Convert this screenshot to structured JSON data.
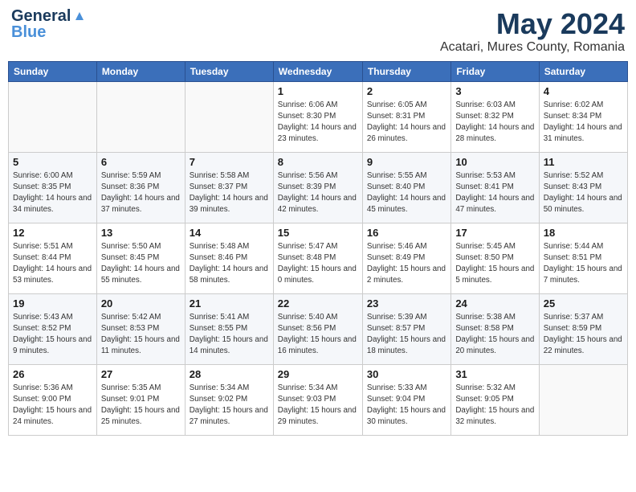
{
  "header": {
    "logo_line1": "General",
    "logo_line2": "Blue",
    "month_year": "May 2024",
    "location": "Acatari, Mures County, Romania"
  },
  "weekdays": [
    "Sunday",
    "Monday",
    "Tuesday",
    "Wednesday",
    "Thursday",
    "Friday",
    "Saturday"
  ],
  "weeks": [
    [
      {
        "day": "",
        "sunrise": "",
        "sunset": "",
        "daylight": ""
      },
      {
        "day": "",
        "sunrise": "",
        "sunset": "",
        "daylight": ""
      },
      {
        "day": "",
        "sunrise": "",
        "sunset": "",
        "daylight": ""
      },
      {
        "day": "1",
        "sunrise": "6:06 AM",
        "sunset": "8:30 PM",
        "daylight": "14 hours and 23 minutes."
      },
      {
        "day": "2",
        "sunrise": "6:05 AM",
        "sunset": "8:31 PM",
        "daylight": "14 hours and 26 minutes."
      },
      {
        "day": "3",
        "sunrise": "6:03 AM",
        "sunset": "8:32 PM",
        "daylight": "14 hours and 28 minutes."
      },
      {
        "day": "4",
        "sunrise": "6:02 AM",
        "sunset": "8:34 PM",
        "daylight": "14 hours and 31 minutes."
      }
    ],
    [
      {
        "day": "5",
        "sunrise": "6:00 AM",
        "sunset": "8:35 PM",
        "daylight": "14 hours and 34 minutes."
      },
      {
        "day": "6",
        "sunrise": "5:59 AM",
        "sunset": "8:36 PM",
        "daylight": "14 hours and 37 minutes."
      },
      {
        "day": "7",
        "sunrise": "5:58 AM",
        "sunset": "8:37 PM",
        "daylight": "14 hours and 39 minutes."
      },
      {
        "day": "8",
        "sunrise": "5:56 AM",
        "sunset": "8:39 PM",
        "daylight": "14 hours and 42 minutes."
      },
      {
        "day": "9",
        "sunrise": "5:55 AM",
        "sunset": "8:40 PM",
        "daylight": "14 hours and 45 minutes."
      },
      {
        "day": "10",
        "sunrise": "5:53 AM",
        "sunset": "8:41 PM",
        "daylight": "14 hours and 47 minutes."
      },
      {
        "day": "11",
        "sunrise": "5:52 AM",
        "sunset": "8:43 PM",
        "daylight": "14 hours and 50 minutes."
      }
    ],
    [
      {
        "day": "12",
        "sunrise": "5:51 AM",
        "sunset": "8:44 PM",
        "daylight": "14 hours and 53 minutes."
      },
      {
        "day": "13",
        "sunrise": "5:50 AM",
        "sunset": "8:45 PM",
        "daylight": "14 hours and 55 minutes."
      },
      {
        "day": "14",
        "sunrise": "5:48 AM",
        "sunset": "8:46 PM",
        "daylight": "14 hours and 58 minutes."
      },
      {
        "day": "15",
        "sunrise": "5:47 AM",
        "sunset": "8:48 PM",
        "daylight": "15 hours and 0 minutes."
      },
      {
        "day": "16",
        "sunrise": "5:46 AM",
        "sunset": "8:49 PM",
        "daylight": "15 hours and 2 minutes."
      },
      {
        "day": "17",
        "sunrise": "5:45 AM",
        "sunset": "8:50 PM",
        "daylight": "15 hours and 5 minutes."
      },
      {
        "day": "18",
        "sunrise": "5:44 AM",
        "sunset": "8:51 PM",
        "daylight": "15 hours and 7 minutes."
      }
    ],
    [
      {
        "day": "19",
        "sunrise": "5:43 AM",
        "sunset": "8:52 PM",
        "daylight": "15 hours and 9 minutes."
      },
      {
        "day": "20",
        "sunrise": "5:42 AM",
        "sunset": "8:53 PM",
        "daylight": "15 hours and 11 minutes."
      },
      {
        "day": "21",
        "sunrise": "5:41 AM",
        "sunset": "8:55 PM",
        "daylight": "15 hours and 14 minutes."
      },
      {
        "day": "22",
        "sunrise": "5:40 AM",
        "sunset": "8:56 PM",
        "daylight": "15 hours and 16 minutes."
      },
      {
        "day": "23",
        "sunrise": "5:39 AM",
        "sunset": "8:57 PM",
        "daylight": "15 hours and 18 minutes."
      },
      {
        "day": "24",
        "sunrise": "5:38 AM",
        "sunset": "8:58 PM",
        "daylight": "15 hours and 20 minutes."
      },
      {
        "day": "25",
        "sunrise": "5:37 AM",
        "sunset": "8:59 PM",
        "daylight": "15 hours and 22 minutes."
      }
    ],
    [
      {
        "day": "26",
        "sunrise": "5:36 AM",
        "sunset": "9:00 PM",
        "daylight": "15 hours and 24 minutes."
      },
      {
        "day": "27",
        "sunrise": "5:35 AM",
        "sunset": "9:01 PM",
        "daylight": "15 hours and 25 minutes."
      },
      {
        "day": "28",
        "sunrise": "5:34 AM",
        "sunset": "9:02 PM",
        "daylight": "15 hours and 27 minutes."
      },
      {
        "day": "29",
        "sunrise": "5:34 AM",
        "sunset": "9:03 PM",
        "daylight": "15 hours and 29 minutes."
      },
      {
        "day": "30",
        "sunrise": "5:33 AM",
        "sunset": "9:04 PM",
        "daylight": "15 hours and 30 minutes."
      },
      {
        "day": "31",
        "sunrise": "5:32 AM",
        "sunset": "9:05 PM",
        "daylight": "15 hours and 32 minutes."
      },
      {
        "day": "",
        "sunrise": "",
        "sunset": "",
        "daylight": ""
      }
    ]
  ]
}
